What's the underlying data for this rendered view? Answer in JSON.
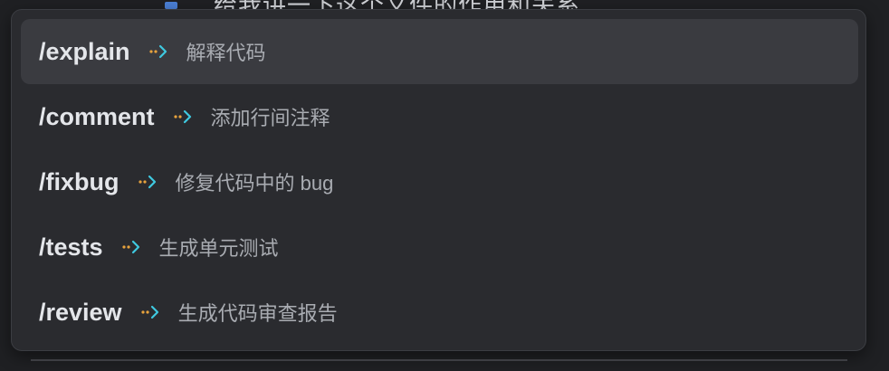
{
  "background": {
    "partial_text": "给我讲一下这个文件的作用和关系"
  },
  "menu": {
    "items": [
      {
        "command": "/explain",
        "description": "解释代码",
        "selected": true
      },
      {
        "command": "/comment",
        "description": "添加行间注释",
        "selected": false
      },
      {
        "command": "/fixbug",
        "description": "修复代码中的 bug",
        "selected": false
      },
      {
        "command": "/tests",
        "description": "生成单元测试",
        "selected": false
      },
      {
        "command": "/review",
        "description": "生成代码审查报告",
        "selected": false
      }
    ]
  },
  "colors": {
    "popup_bg": "#2a2b2f",
    "selected_bg": "#3a3b40",
    "arrow_dots": "#e8a33d",
    "arrow_chevron": "#3fc9e0"
  },
  "icons": {
    "item_arrow": "arrow-right-icon"
  }
}
